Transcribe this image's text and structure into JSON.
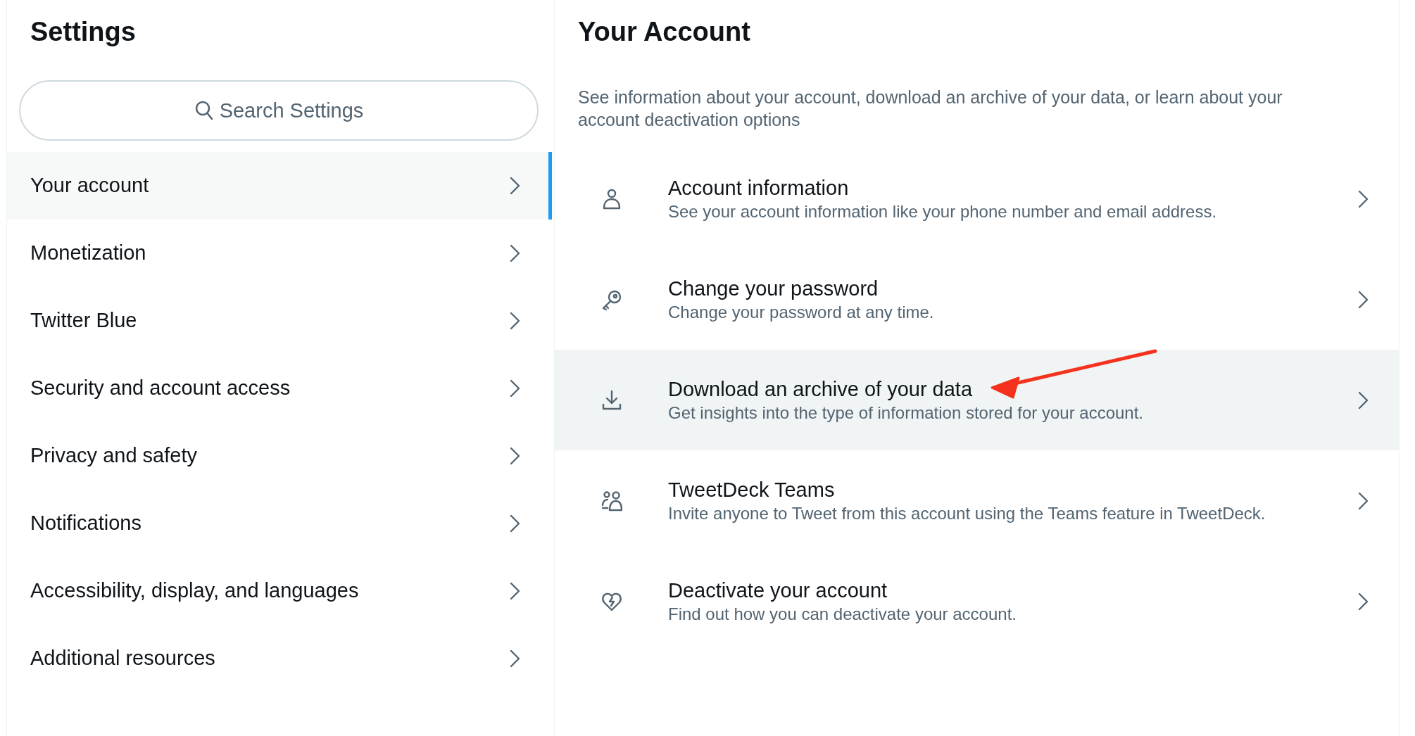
{
  "settings": {
    "title": "Settings",
    "search": {
      "placeholder": "Search Settings"
    },
    "nav_items": [
      {
        "label": "Your account",
        "selected": true
      },
      {
        "label": "Monetization",
        "selected": false
      },
      {
        "label": "Twitter Blue",
        "selected": false
      },
      {
        "label": "Security and account access",
        "selected": false
      },
      {
        "label": "Privacy and safety",
        "selected": false
      },
      {
        "label": "Notifications",
        "selected": false
      },
      {
        "label": "Accessibility, display, and languages",
        "selected": false
      },
      {
        "label": "Additional resources",
        "selected": false
      }
    ]
  },
  "account": {
    "title": "Your Account",
    "description": "See information about your account, download an archive of your data, or learn about your account deactivation options",
    "items": [
      {
        "kind": "person",
        "title": "Account information",
        "subtitle": "See your account information like your phone number and email address.",
        "hovered": false
      },
      {
        "kind": "key",
        "title": "Change your password",
        "subtitle": "Change your password at any time.",
        "hovered": false
      },
      {
        "kind": "download",
        "title": "Download an archive of your data",
        "subtitle": "Get insights into the type of information stored for your account.",
        "hovered": true
      },
      {
        "kind": "people",
        "title": "TweetDeck Teams",
        "subtitle": "Invite anyone to Tweet from this account using the Teams feature in TweetDeck.",
        "hovered": false
      },
      {
        "kind": "heart",
        "title": "Deactivate your account",
        "subtitle": "Find out how you can deactivate your account.",
        "hovered": false
      }
    ]
  }
}
